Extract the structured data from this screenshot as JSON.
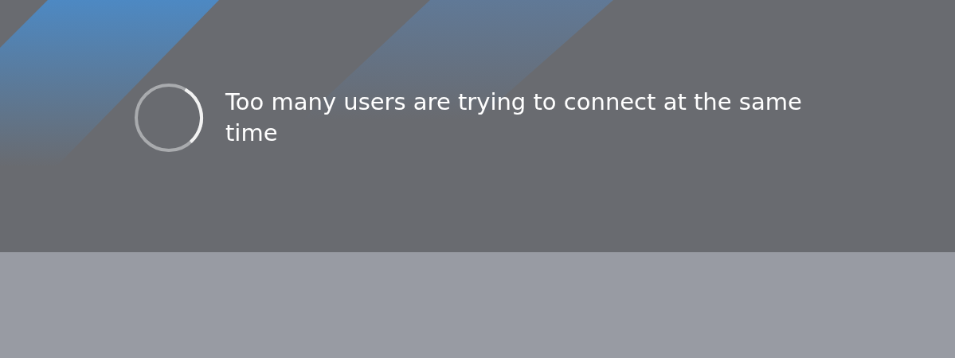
{
  "dialog": {
    "message": "Too many users are trying to connect at the same time"
  }
}
